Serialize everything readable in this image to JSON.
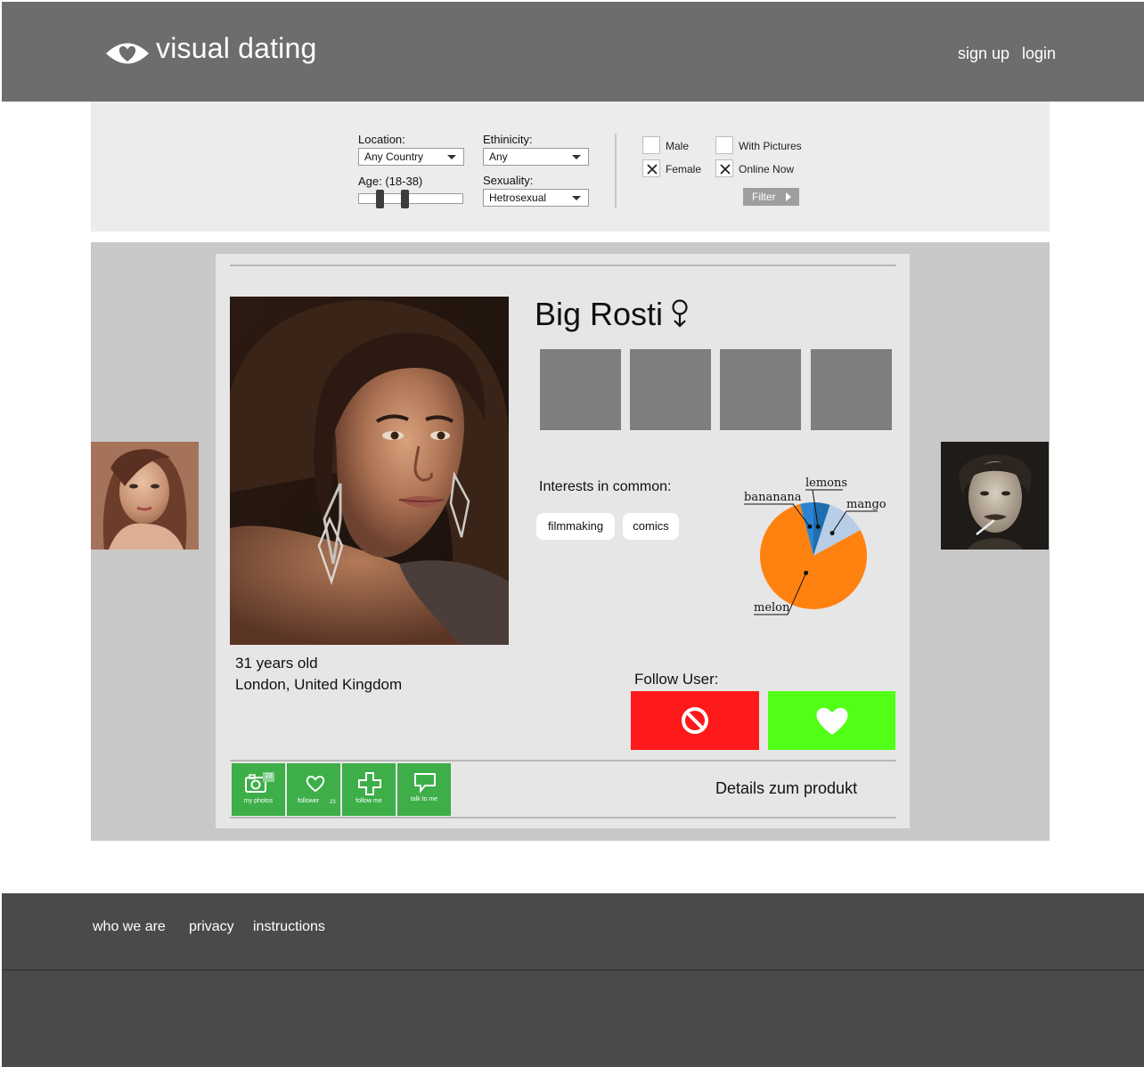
{
  "header": {
    "brand": "visual dating",
    "signup_label": "sign up",
    "login_label": "login"
  },
  "filter": {
    "location_label": "Location:",
    "location_value": "Any Country",
    "ethnicity_label": "Ethinicity:",
    "ethnicity_value": "Any",
    "age_label": "Age: (18-38)",
    "age_range": [
      18,
      38
    ],
    "sexuality_label": "Sexuality:",
    "sexuality_value": "Hetrosexual",
    "male_label": "Male",
    "male_checked": false,
    "female_label": "Female",
    "female_checked": true,
    "with_pictures_label": "With Pictures",
    "with_pictures_checked": false,
    "online_now_label": "Online Now",
    "online_now_checked": true,
    "filter_button": "Filter"
  },
  "profile": {
    "name": "Big Rosti",
    "gender_icon": "female-symbol-icon",
    "age": "31 years old",
    "location": "London, United Kingdom",
    "interests_title": "Interests in common:",
    "interests": [
      "filmmaking",
      "comics"
    ],
    "follow_label": "Follow User:",
    "details_link": "Details zum produkt"
  },
  "chart_data": {
    "type": "pie",
    "labels": [
      "lemons",
      "mango",
      "melon",
      "bananana"
    ],
    "values": [
      5,
      12,
      79,
      4
    ],
    "colors": [
      "#1f6fb0",
      "#b8cde6",
      "#ff8210",
      "#2a84d2"
    ]
  },
  "tiles": [
    {
      "label": "my photos",
      "icon": "camera-icon",
      "badge": "23"
    },
    {
      "label": "follower",
      "icon": "heart-icon",
      "badge": "23"
    },
    {
      "label": "follow me",
      "icon": "plus-icon",
      "badge": ""
    },
    {
      "label": "talk to me",
      "icon": "speech-bubble-icon",
      "badge": ""
    }
  ],
  "footer": {
    "who_we_are": "who we are",
    "privacy": "privacy",
    "instructions": "instructions"
  },
  "colors": {
    "header_bg": "#6d6d6d",
    "reject": "#fe1a1a",
    "like": "#52ff16",
    "tile": "#3dae48",
    "footer_bg": "#4a4a4c"
  }
}
